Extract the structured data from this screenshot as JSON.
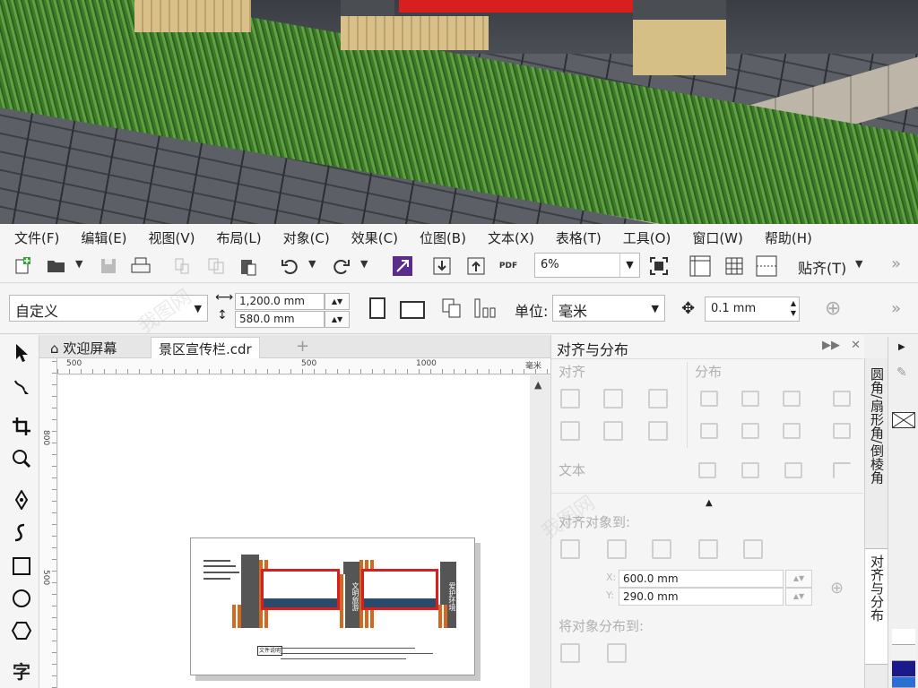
{
  "menu": [
    "文件(F)",
    "编辑(E)",
    "视图(V)",
    "布局(L)",
    "对象(C)",
    "效果(C)",
    "位图(B)",
    "文本(X)",
    "表格(T)",
    "工具(O)",
    "窗口(W)",
    "帮助(H)"
  ],
  "toolbar": {
    "zoom_value": "6%",
    "pdf_label": "PDF",
    "snap_label": "贴齐(T)",
    "overflow": "»"
  },
  "propbar": {
    "preset": "自定义",
    "width": "1,200.0 mm",
    "height": "580.0 mm",
    "unit_label": "单位:",
    "unit_value": "毫米",
    "nudge": "0.1 mm",
    "overflow": "»"
  },
  "tabs": {
    "welcome": "欢迎屏幕",
    "document": "景区宣传栏.cdr",
    "add": "+"
  },
  "ruler": {
    "h_ticks": [
      "500",
      "500",
      "1000",
      "毫米"
    ],
    "v_ticks": [
      "800",
      "500"
    ]
  },
  "drawing": {
    "board1_label": "文明旅游",
    "board2_label": "爱护环境",
    "footer_box": "文件说明"
  },
  "docker": {
    "title": "对齐与分布",
    "ctrl_expand": "▶▶",
    "ctrl_close": "✕",
    "align_label": "对齐",
    "distribute_label": "分布",
    "text_label": "文本",
    "align_to_label": "对齐对象到:",
    "distribute_to_label": "将对象分布到:",
    "x_label": "X:",
    "y_label": "Y:",
    "x_value": "600.0 mm",
    "y_value": "290.0 mm"
  },
  "vertical_tabs": {
    "fillet": "圆角/扇形角/倒棱角",
    "align": "对齐与分布"
  },
  "palette": [
    "#ffffff",
    "#f2f2f2",
    "#1a1a8c",
    "#2b6fd6"
  ],
  "watermark_text": "我图网"
}
